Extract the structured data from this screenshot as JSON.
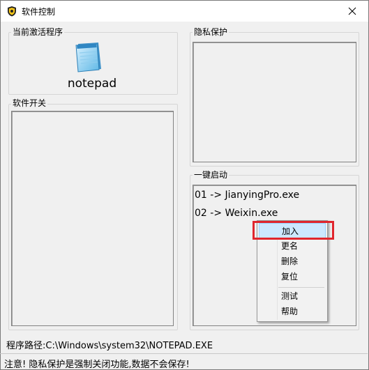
{
  "window": {
    "title": "软件控制"
  },
  "groups": {
    "active_program": {
      "label": "当前激活程序",
      "app_name": "notepad"
    },
    "software_switch": {
      "label": "软件开关"
    },
    "privacy": {
      "label": "隐私保护"
    },
    "one_click_start": {
      "label": "一键启动",
      "items": [
        "01 -> JianyingPro.exe",
        "02 -> Weixin.exe"
      ]
    }
  },
  "context_menu": {
    "items": [
      "加入",
      "更名",
      "删除",
      "复位",
      "测试",
      "帮助"
    ],
    "highlighted": "加入"
  },
  "program_path": "程序路径:C:\\Windows\\system32\\NOTEPAD.EXE",
  "status_bar": {
    "text": "注意! 隐私保护是强制关闭功能,数据不会保存!"
  },
  "colors": {
    "highlight": "#cce8ff",
    "annotation": "#e0262d"
  }
}
